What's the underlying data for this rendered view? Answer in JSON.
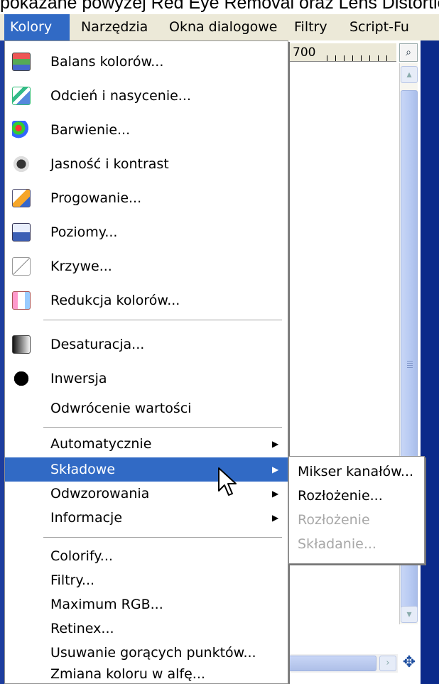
{
  "caption": "pokazane powyżej Red Eye Removal oraz Lens Distortion",
  "menubar": {
    "items": [
      {
        "label": "Kolory",
        "active": true
      },
      {
        "label": "Narzędzia"
      },
      {
        "label": "Okna dialogowe"
      },
      {
        "label": "Filtry"
      },
      {
        "label": "Script-Fu"
      }
    ]
  },
  "ruler_label": "700",
  "menu": {
    "items": [
      {
        "label": "Balans kolorów...",
        "icon": "color-balance-icon"
      },
      {
        "label": "Odcień i nasycenie...",
        "icon": "hue-saturation-icon"
      },
      {
        "label": "Barwienie...",
        "icon": "colorize-icon"
      },
      {
        "label": "Jasność i kontrast",
        "icon": "brightness-contrast-icon"
      },
      {
        "label": "Progowanie...",
        "icon": "threshold-icon"
      },
      {
        "label": "Poziomy...",
        "icon": "levels-icon"
      },
      {
        "label": "Krzywe...",
        "icon": "curves-icon"
      },
      {
        "label": "Redukcja kolorów...",
        "icon": "posterize-icon"
      },
      {
        "label": "Desaturacja...",
        "icon": "desaturate-icon"
      },
      {
        "label": "Inwersja",
        "icon": "invert-icon"
      },
      {
        "label": "Odwrócenie wartości"
      },
      {
        "label": "Automatycznie",
        "submenu": true
      },
      {
        "label": "Składowe",
        "submenu": true,
        "highlighted": true
      },
      {
        "label": "Odwzorowania",
        "submenu": true
      },
      {
        "label": "Informacje",
        "submenu": true
      },
      {
        "label": "Colorify..."
      },
      {
        "label": "Filtry..."
      },
      {
        "label": "Maximum RGB..."
      },
      {
        "label": "Retinex..."
      },
      {
        "label": "Usuwanie gorących punktów..."
      },
      {
        "label": "Zmiana koloru w alfę..."
      }
    ]
  },
  "submenu": {
    "items": [
      {
        "label": "Mikser kanałów...",
        "enabled": true
      },
      {
        "label": "Rozłożenie...",
        "enabled": true
      },
      {
        "label": "Rozłożenie",
        "enabled": false
      },
      {
        "label": "Składanie...",
        "enabled": false
      }
    ]
  },
  "colors": {
    "highlight": "#316ac5",
    "menubar_bg": "#ece9d8",
    "frame": "#0b2a8a"
  }
}
